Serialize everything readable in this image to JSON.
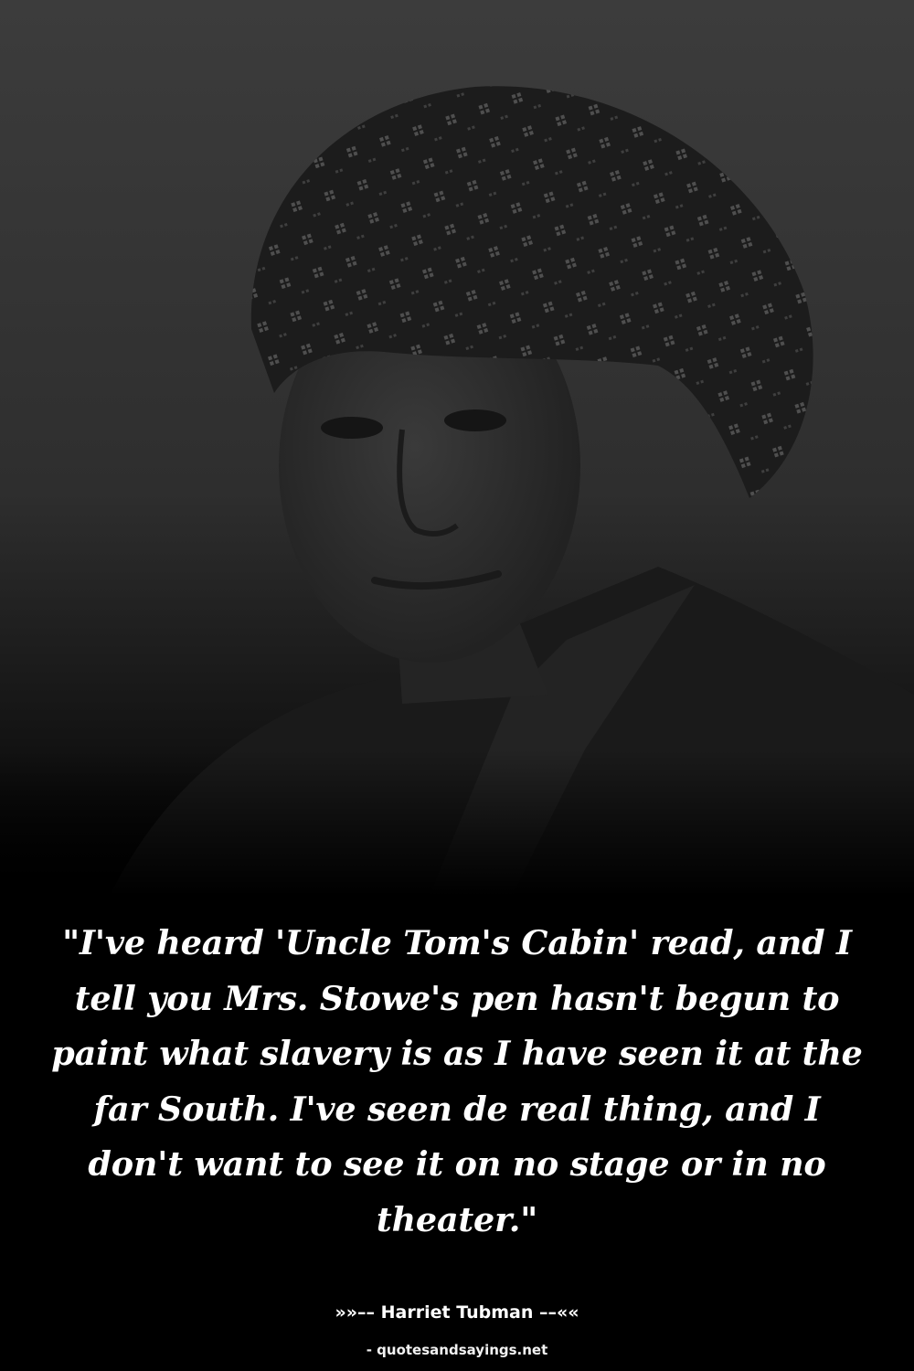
{
  "quote": {
    "text": "\"I've heard 'Uncle Tom's Cabin' read, and I tell you Mrs. Stowe's pen hasn't begun to paint what slavery is as I have seen it at the far South. I've seen de real thing, and I don't want to see it on no stage or in no theater.\""
  },
  "attribution": {
    "text": "»»–– Harriet Tubman ––««"
  },
  "source": {
    "text": "- quotesandsayings.net"
  },
  "colors": {
    "background": "#000000",
    "text": "#ffffff",
    "photo_tone": "#3a3a3a"
  }
}
